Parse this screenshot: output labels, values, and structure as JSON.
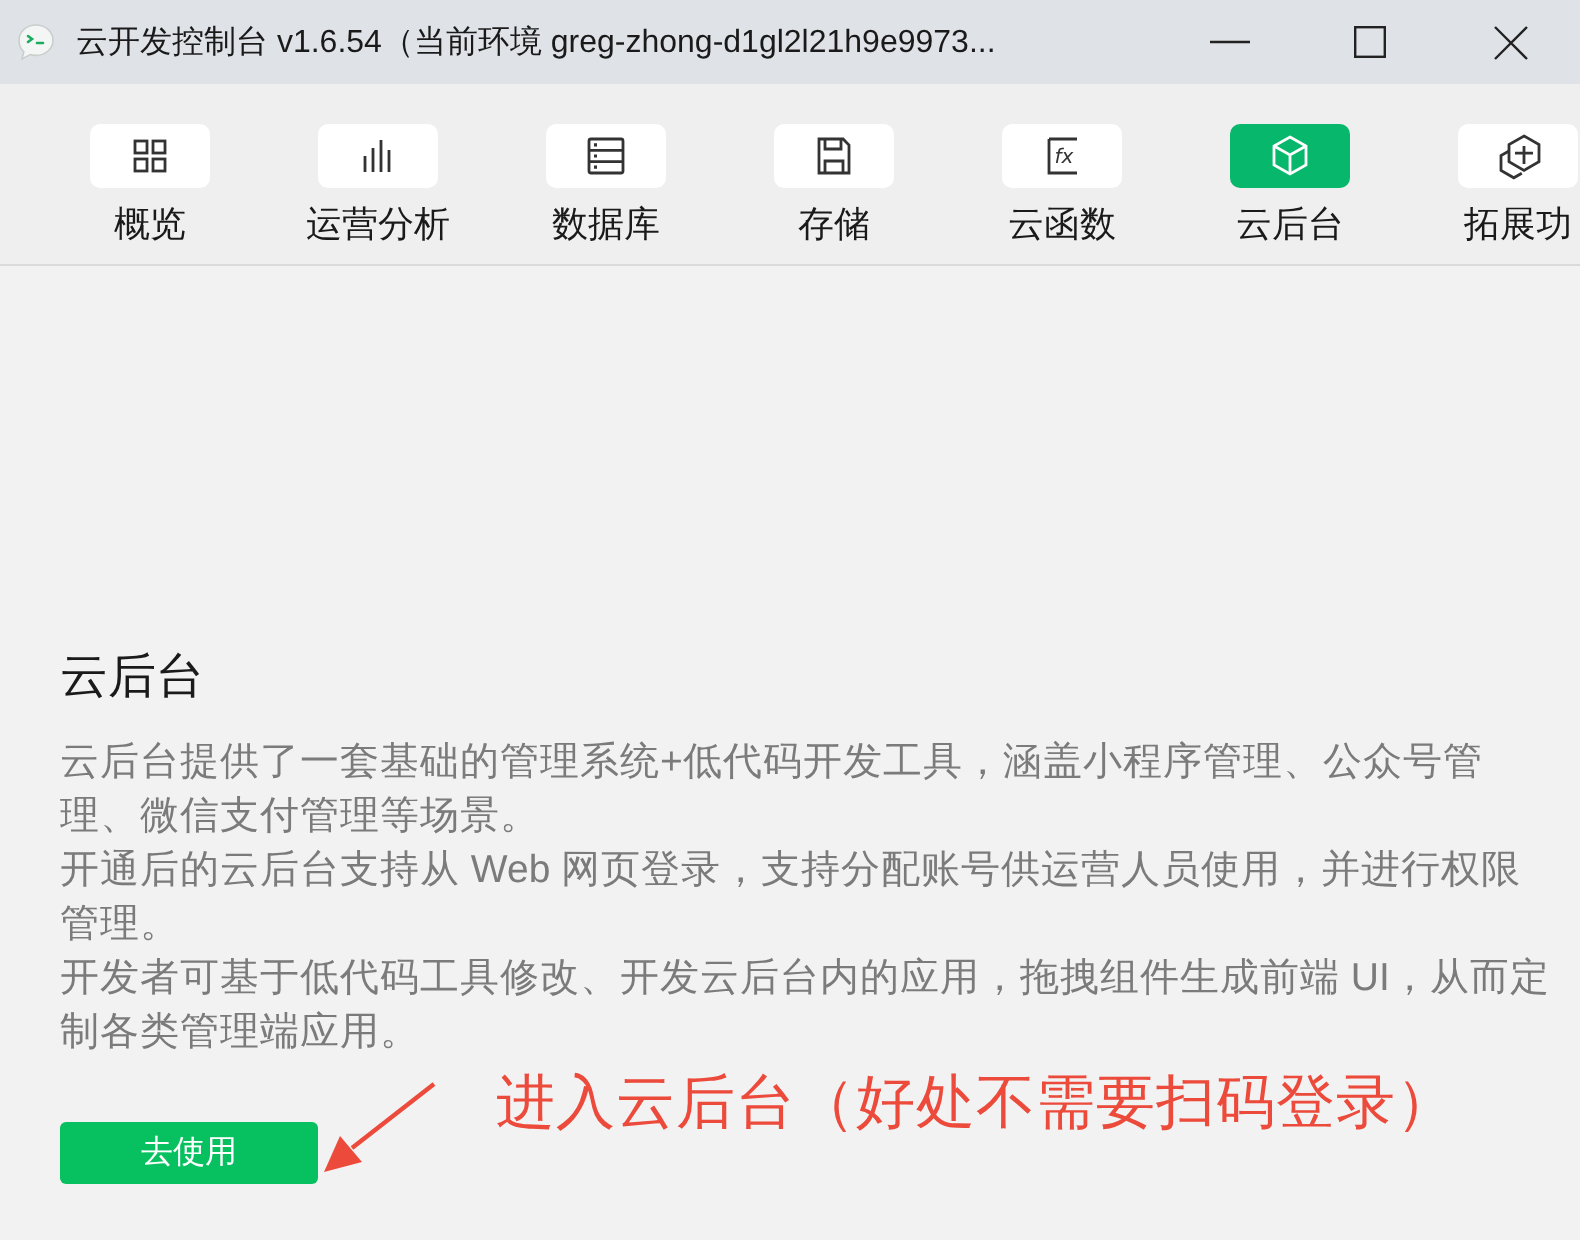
{
  "window": {
    "title": "云开发控制台 v1.6.54（当前环境 greg-zhong-d1gl2l21h9e9973..."
  },
  "tabs": [
    {
      "label": "概览",
      "kind": "grid",
      "selected": false
    },
    {
      "label": "运营分析",
      "kind": "bars",
      "selected": false
    },
    {
      "label": "数据库",
      "kind": "database",
      "selected": false
    },
    {
      "label": "存储",
      "kind": "floppy",
      "selected": false
    },
    {
      "label": "云函数",
      "kind": "function",
      "glyph": "fx",
      "selected": false
    },
    {
      "label": "云后台",
      "kind": "cube",
      "selected": true
    },
    {
      "label": "拓展功",
      "kind": "extension",
      "selected": false
    }
  ],
  "panel": {
    "title": "云后台",
    "paragraphs": [
      "云后台提供了一套基础的管理系统+低代码开发工具，涵盖小程序管理、公众号管理、微信支付管理等场景。",
      "开通后的云后台支持从 Web 网页登录，支持分配账号供运营人员使用，并进行权限管理。",
      "开发者可基于低代码工具修改、开发云后台内的应用，拖拽组件生成前端 UI，从而定制各类管理端应用。"
    ],
    "button": "去使用"
  },
  "annotation": {
    "text": "进入云后台（好处不需要扫码登录）"
  }
}
